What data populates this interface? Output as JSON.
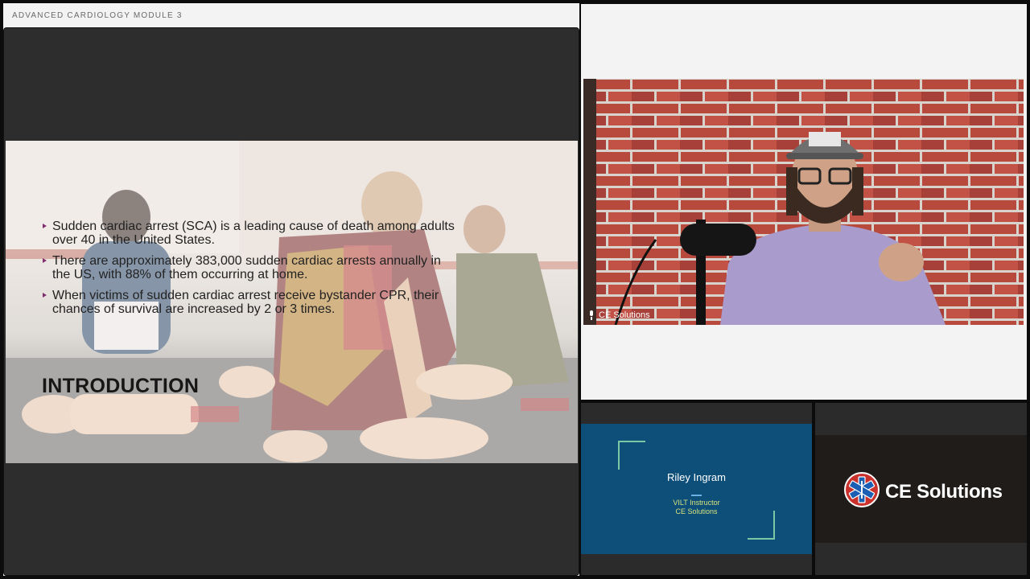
{
  "slide": {
    "module_title": "ADVANCED CARDIOLOGY MODULE 3",
    "bullets": [
      "Sudden cardiac arrest (SCA) is a leading cause of death among adults over 40 in the United States.",
      "There are approximately 383,000 sudden cardiac arrests annually in the US, with 88% of them occurring at home.",
      "When victims of sudden cardiac arrest receive bystander CPR, their chances of survival are increased by 2 or 3 times."
    ],
    "heading": "INTRODUCTION",
    "accent_color": "#7f2d6e"
  },
  "webcam": {
    "participant_name": "CE Solutions",
    "mic_icon": "microphone-icon"
  },
  "instructor_card": {
    "name": "Riley Ingram",
    "role": "VILT Instructor",
    "organization": "CE Solutions",
    "background_color": "#0e4f7a",
    "accent_color": "#7cc7a5"
  },
  "logo_tile": {
    "brand_text": "CE Solutions",
    "logo_icon": "star-of-life-icon"
  }
}
